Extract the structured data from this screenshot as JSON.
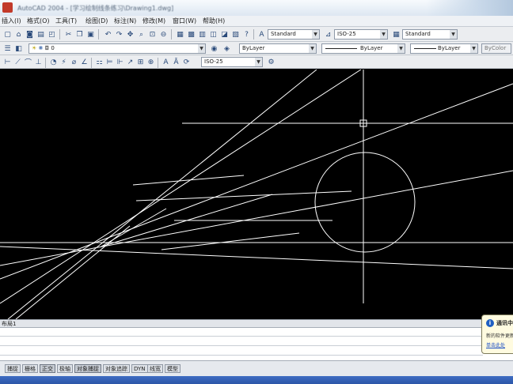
{
  "window": {
    "title": "AutoCAD 2004 - [学习绘制线条练习\\Drawing1.dwg]"
  },
  "menu": {
    "items": [
      "插入(I)",
      "格式(O)",
      "工具(T)",
      "绘图(D)",
      "标注(N)",
      "修改(M)",
      "窗口(W)",
      "帮助(H)"
    ]
  },
  "toolbar": {
    "text_style": "Standard",
    "dim_style": "ISO-25",
    "table_style": "Standard",
    "layer": "0",
    "color": "ByLayer",
    "linetype": "ByLayer",
    "lineweight": "ByLayer",
    "plot_style": "ByColor",
    "dim_style_2": "ISO-25"
  },
  "tabs": {
    "label": "布局1"
  },
  "status": {
    "buttons": [
      "捕捉",
      "栅格",
      "正交",
      "极轴",
      "对象捕捉",
      "对象追踪",
      "DYN",
      "线宽",
      "模型"
    ]
  },
  "balloon": {
    "title": "通讯中心",
    "text": "新的软件更新",
    "link": "单击此处"
  },
  "colors": {
    "canvas": "#000000",
    "lines": "#ffffff",
    "crosshair": "#ffffff",
    "toolbar": "#ebedf0"
  },
  "icons": {
    "toolbar1": [
      "new-icon",
      "open-icon",
      "save-icon",
      "print-icon",
      "preview-icon",
      "publish-icon",
      "cut-icon",
      "copy-icon",
      "paste-icon",
      "match-icon",
      "undo-icon",
      "redo-icon",
      "pan-icon",
      "zoom-icon",
      "zoom-window-icon",
      "zoom-previous-icon",
      "properties-icon",
      "design-center-icon",
      "tool-palettes-icon",
      "sheet-set-icon",
      "markup-icon",
      "calc-icon",
      "help-icon"
    ],
    "toolbar2": [
      "layer-manager-icon",
      "layer-state-icon",
      "layer-previous-icon"
    ],
    "toolbar3": [
      "linear-dim-icon",
      "aligned-dim-icon",
      "arc-length-icon",
      "ordinate-icon",
      "radius-icon",
      "jogged-icon",
      "diameter-icon",
      "angular-icon",
      "quick-dim-icon",
      "baseline-icon",
      "continue-icon",
      "leader-icon",
      "tolerance-icon",
      "center-mark-icon",
      "dim-edit-icon",
      "dim-text-edit-icon",
      "dim-update-icon",
      "dim-style-icon"
    ]
  }
}
